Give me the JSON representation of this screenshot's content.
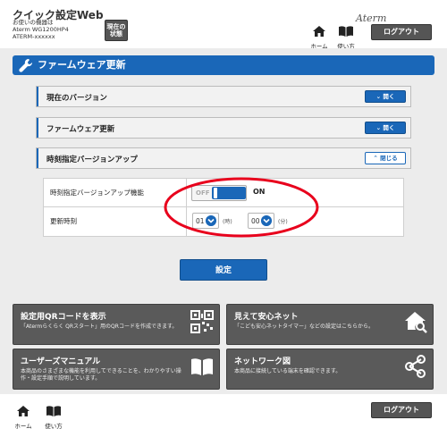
{
  "header": {
    "title": "クイック設定Web",
    "model_label": "お使いの機器は",
    "model_name": "Aterm WG1200HP4",
    "model_id": "ATERM-xxxxxx",
    "status_button": [
      "現在の",
      "状態"
    ],
    "home_label": "ホーム",
    "manual_label": "使い方",
    "brand": "Aterm",
    "logout_label": "ログアウト"
  },
  "page": {
    "title": "ファームウェア更新"
  },
  "sections": [
    {
      "label": "現在のバージョン",
      "button": "開く",
      "state": "closed"
    },
    {
      "label": "ファームウェア更新",
      "button": "開く",
      "state": "closed"
    },
    {
      "label": "時刻指定バージョンアップ",
      "button": "閉じる",
      "state": "open"
    }
  ],
  "settings": {
    "auto_update": {
      "label": "時刻指定バージョンアップ機能",
      "off_label": "OFF",
      "on_label": "ON",
      "value": "ON"
    },
    "update_time": {
      "label": "更新時刻",
      "hour": "01",
      "hour_unit": "(時)",
      "minute": "00",
      "minute_unit": "(分)"
    }
  },
  "apply_button": "設定",
  "cards": [
    {
      "title": "設定用QRコードを表示",
      "desc": "「Atermらくらく QRスタート」用のQRコードを作成できます。",
      "icon": "qr-code-icon"
    },
    {
      "title": "見えて安心ネット",
      "desc": "「こども安心ネットタイマー」などの設定はこちらから。",
      "icon": "home-search-icon"
    },
    {
      "title": "ユーザーズマニュアル",
      "desc": "本商品のさまざまな機能を利用してできることを、わかりやすい操作・設定手順で説明しています。",
      "icon": "book-icon"
    },
    {
      "title": "ネットワーク図",
      "desc": "本商品に接続している端末を確認できます。",
      "icon": "network-icon"
    }
  ],
  "footer": {
    "home_label": "ホーム",
    "manual_label": "使い方",
    "logout_label": "ログアウト"
  },
  "colors": {
    "accent": "#1a67b8",
    "highlight": "#e8001c",
    "card_bg": "#5a5a5a"
  }
}
